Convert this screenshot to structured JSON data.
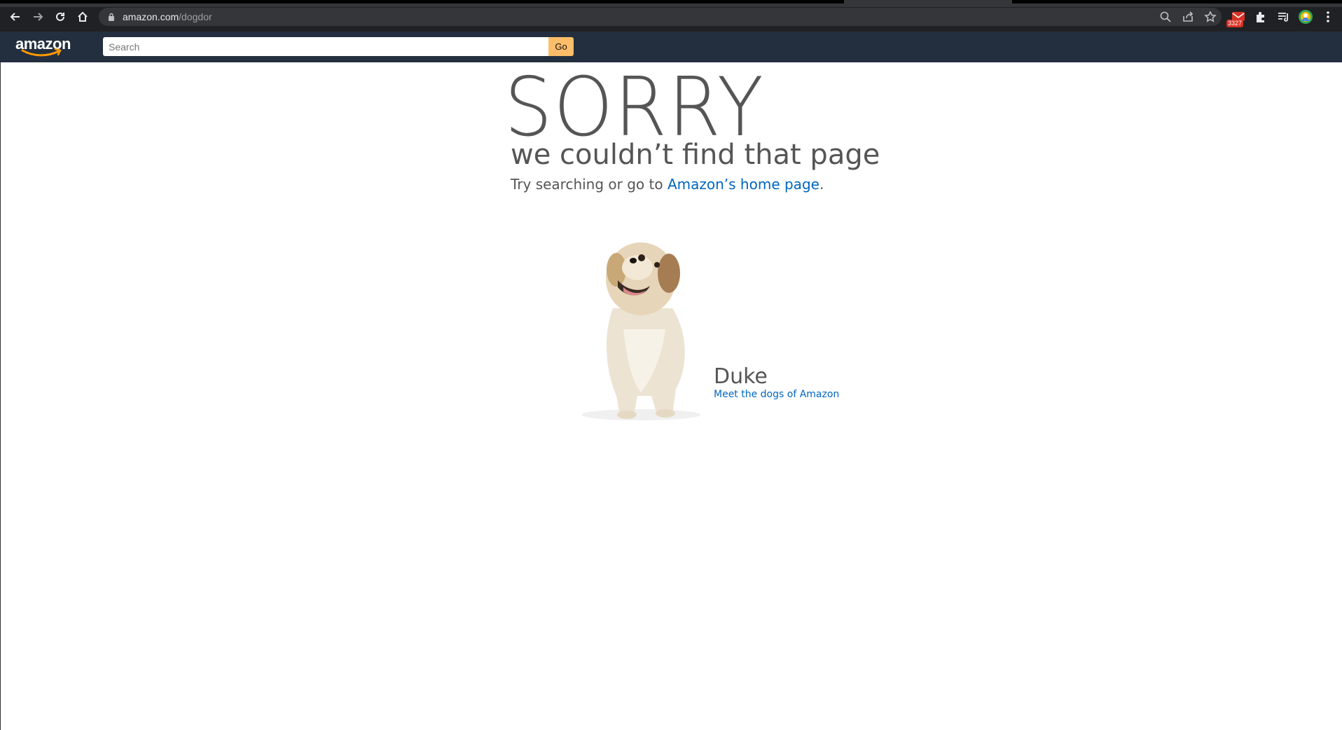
{
  "browser": {
    "url_host": "amazon.com",
    "url_path": "/dogdor",
    "extension_badge": "3327",
    "icons": [
      "back-icon",
      "forward-icon",
      "reload-icon",
      "home-icon",
      "lock-icon",
      "zoom-icon",
      "share-icon",
      "bookmark-star-icon",
      "gmail-extension-icon",
      "extensions-puzzle-icon",
      "reading-list-icon",
      "profile-avatar-icon",
      "menu-dots-icon"
    ]
  },
  "header": {
    "logo_text": "amazon",
    "search_placeholder": "Search",
    "go_label": "Go",
    "colors": {
      "background": "#232f3e",
      "go_button": "#febd69",
      "logo_smile": "#ff9900"
    }
  },
  "main": {
    "title": "SORRY",
    "subtitle": "we couldn’t find that page",
    "try_prefix": "Try searching or go to ",
    "home_link": "Amazon’s home page",
    "try_suffix": ".",
    "dog_name": "Duke",
    "dogs_link": "Meet the dogs of Amazon",
    "colors": {
      "text": "#555555",
      "link": "#0066c0"
    }
  }
}
